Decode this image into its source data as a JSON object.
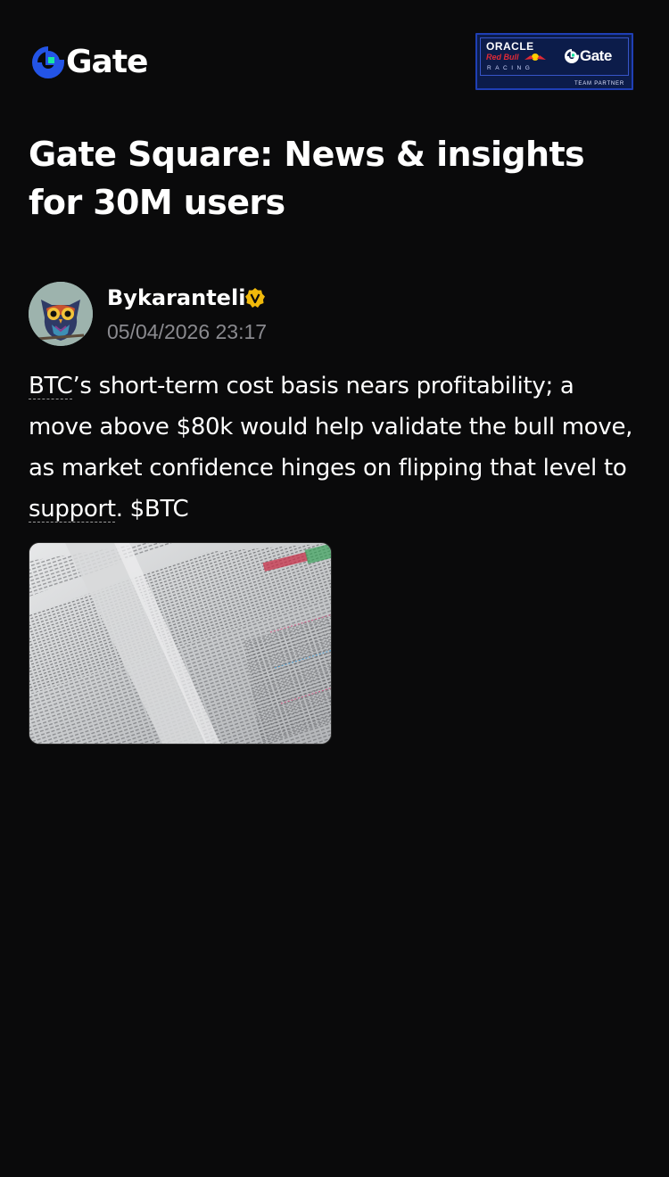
{
  "header": {
    "logo_text": "Gate",
    "partner": {
      "oracle": "ORACLE",
      "red_bull": "Red Bull",
      "racing": "RACING",
      "gate": "Gate",
      "team_partner": "TEAM PARTNER"
    }
  },
  "page": {
    "title": "Gate Square: News & insights for 30M users"
  },
  "post": {
    "author": "Bykaranteli",
    "verified_icon": "verified-badge-icon",
    "timestamp": "05/04/2026 23:17",
    "text": {
      "tag_btc": "BTC",
      "part1": "’s short-term cost basis nears profitability; a move above $80k would help validate the bull move, as market confidence hinges on flipping that level to ",
      "tag_support": "support",
      "part2": ". ",
      "cashtag": "$BTC"
    },
    "image_icon": "newspaper-stock-listings-image"
  },
  "colors": {
    "background": "#0a0a0b",
    "text": "#ffffff",
    "muted": "#8a8a8f",
    "brand_blue": "#2354e6",
    "brand_green": "#17e6a1",
    "badge_gold": "#f0b90b"
  }
}
